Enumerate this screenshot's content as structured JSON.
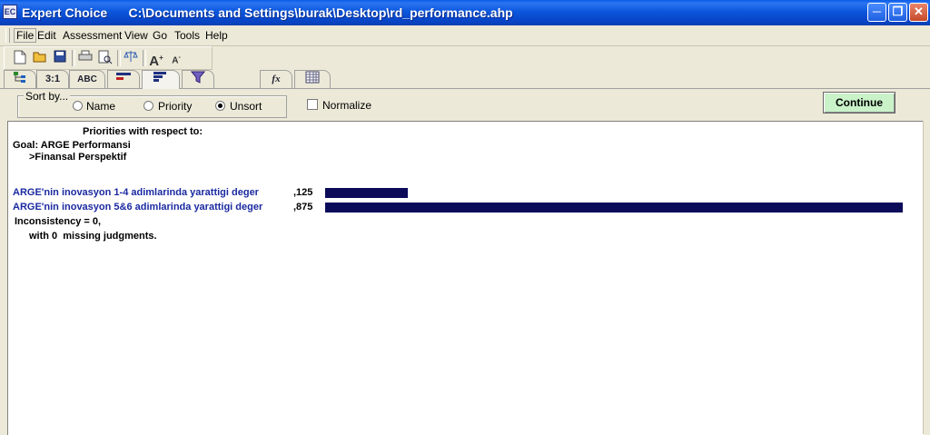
{
  "window": {
    "app_name": "Expert Choice",
    "file_path": "C:\\Documents and Settings\\burak\\Desktop\\rd_performance.ahp",
    "app_icon": "EC"
  },
  "menu": {
    "items": [
      "File",
      "Edit",
      "Assessment",
      "View",
      "Go",
      "Tools",
      "Help"
    ]
  },
  "toolbar": {
    "icons": [
      "new-icon",
      "open-icon",
      "save-icon",
      "print-icon",
      "print-preview-icon",
      "balance-icon",
      "font-increase-icon",
      "font-decrease-icon"
    ]
  },
  "tabs": {
    "items": [
      {
        "label": "",
        "icon": "tree-view-icon"
      },
      {
        "label": "3:1",
        "icon": "numerical-icon"
      },
      {
        "label": "ABC",
        "icon": "verbal-icon"
      },
      {
        "label": "",
        "icon": "graphical-icon"
      },
      {
        "label": "",
        "icon": "priorities-icon"
      },
      {
        "label": "",
        "icon": "filter-icon"
      },
      {
        "label": "fx",
        "icon": "formula-icon"
      },
      {
        "label": "",
        "icon": "grid-icon"
      }
    ]
  },
  "options": {
    "sort_by_label": "Sort by...",
    "sort_options": [
      "Name",
      "Priority",
      "Unsort"
    ],
    "selected_sort": "Unsort",
    "normalize_label": "Normalize",
    "normalize_checked": false,
    "continue_label": "Continue"
  },
  "results": {
    "heading": "Priorities with respect to:",
    "goal": "Goal: ARGE Performansi",
    "node": ">Finansal Perspektif",
    "alternatives": [
      {
        "name": "ARGE'nin inovasyon 1-4 adimlarinda yarattigi deger",
        "value_label": ",125",
        "value": 0.125
      },
      {
        "name": "ARGE'nin inovasyon 5&6 adimlarinda yarattigi deger",
        "value_label": ",875",
        "value": 0.875
      }
    ],
    "inconsistency": "Inconsistency = 0,",
    "missing": "with 0  missing judgments."
  },
  "colors": {
    "bar": "#0b0b5a",
    "alt_text": "#1a2aa0",
    "continue_bg": "#c9f2c9"
  }
}
